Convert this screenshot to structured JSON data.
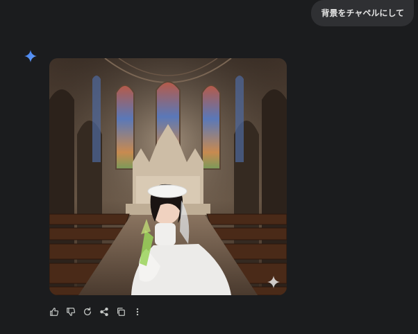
{
  "user_message": "背景をチャペルにして",
  "response": {
    "image_alt": "",
    "actions": [
      {
        "name": "thumbs-up-button",
        "icon": "thumbs-up-icon"
      },
      {
        "name": "thumbs-down-button",
        "icon": "thumbs-down-icon"
      },
      {
        "name": "regenerate-button",
        "icon": "refresh-icon"
      },
      {
        "name": "share-button",
        "icon": "share-icon"
      },
      {
        "name": "copy-button",
        "icon": "copy-icon"
      },
      {
        "name": "more-options-button",
        "icon": "more-vert-icon"
      }
    ]
  },
  "colors": {
    "background": "#1b1c1e",
    "bubble": "#2f3033",
    "gem_blue": "#4a90f0",
    "icon": "#c4c7c5"
  }
}
